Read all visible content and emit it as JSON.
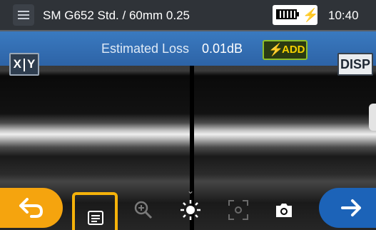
{
  "header": {
    "title": "SM G652 Std. / 60mm 0.25",
    "battery_icon": "battery-charging-icon",
    "clock": "10:40"
  },
  "loss": {
    "label": "Estimated Loss",
    "value": "0.01dB",
    "add_label": "ADD"
  },
  "view_buttons": {
    "xy_left": "X",
    "xy_right": "Y",
    "disp": "DISP"
  },
  "toolbar": {
    "icons": [
      "back-arrow-icon",
      "menu-list-icon",
      "zoom-in-icon",
      "brightness-icon",
      "focus-target-icon",
      "camera-icon",
      "forward-arrow-icon"
    ]
  },
  "colors": {
    "topbar": "#2f3338",
    "lossbar": "#3a7ac0",
    "back_button": "#f5a40e",
    "forward_button": "#1c63b8",
    "menu_highlight": "#f5b20a"
  }
}
